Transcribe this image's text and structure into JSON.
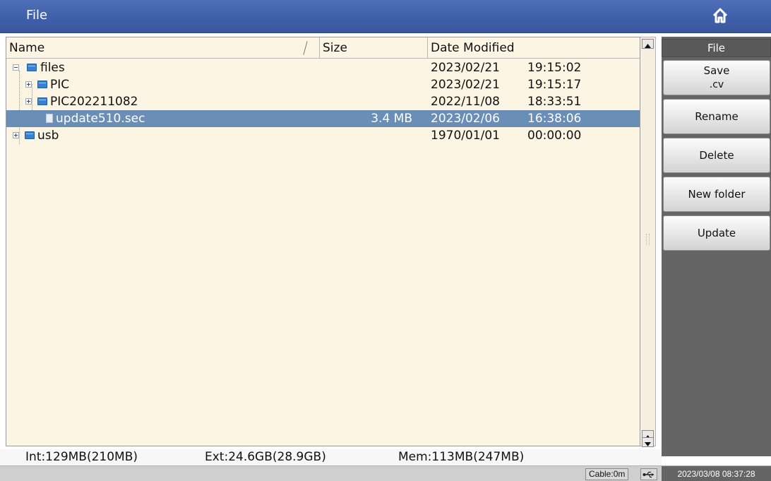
{
  "window": {
    "title": "File"
  },
  "table": {
    "columns": {
      "name": "Name",
      "size": "Size",
      "date": "Date Modified"
    },
    "rows": [
      {
        "name": "files",
        "size": "",
        "date": "2023/02/21",
        "time": "19:15:02",
        "type": "folder",
        "expanded": true
      },
      {
        "name": "PIC",
        "size": "",
        "date": "2023/02/21",
        "time": "19:15:17",
        "type": "folder",
        "expanded": false
      },
      {
        "name": "PIC202211082",
        "size": "",
        "date": "2022/11/08",
        "time": "18:33:51",
        "type": "folder",
        "expanded": false
      },
      {
        "name": "update510.sec",
        "size": "3.4 MB",
        "date": "2023/02/06",
        "time": "16:38:06",
        "type": "file",
        "selected": true
      },
      {
        "name": "usb",
        "size": "",
        "date": "1970/01/01",
        "time": "00:00:00",
        "type": "folder",
        "expanded": false
      }
    ]
  },
  "sidebar": {
    "header": "File",
    "buttons": [
      {
        "line1": "Save",
        "line2": ".cv"
      },
      {
        "line1": "Rename",
        "line2": ""
      },
      {
        "line1": "Delete",
        "line2": ""
      },
      {
        "line1": "New folder",
        "line2": ""
      },
      {
        "line1": "Update",
        "line2": ""
      }
    ]
  },
  "status": {
    "internal": "Int:129MB(210MB)",
    "external": "Ext:24.6GB(28.9GB)",
    "memory": "Mem:113MB(247MB)"
  },
  "bottom_bar": {
    "cable": "Cable:0m",
    "datetime": "2023/03/08 08:37:28"
  },
  "colors": {
    "title_bar": "#4466b0",
    "list_background": "#fdf5e4",
    "selection": "#6b8eb6",
    "side_panel": "#656565"
  },
  "icons": {
    "home": "home-icon",
    "folder": "folder-icon",
    "file": "file-icon",
    "usb": "usb-icon"
  }
}
